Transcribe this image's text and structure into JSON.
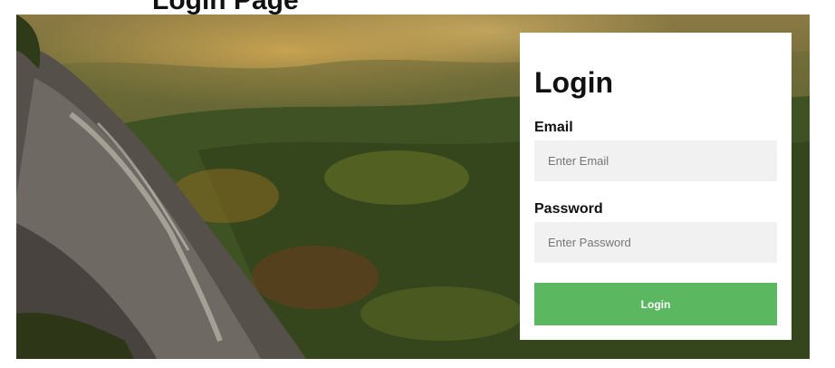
{
  "page": {
    "heading_partial": "Login Page"
  },
  "login_form": {
    "title": "Login",
    "email_label": "Email",
    "email_placeholder": "Enter Email",
    "email_value": "",
    "password_label": "Password",
    "password_placeholder": "Enter Password",
    "password_value": "",
    "submit_label": "Login"
  },
  "colors": {
    "button_bg": "#5cb860",
    "input_bg": "#f1f1f1",
    "card_bg": "#ffffff"
  }
}
